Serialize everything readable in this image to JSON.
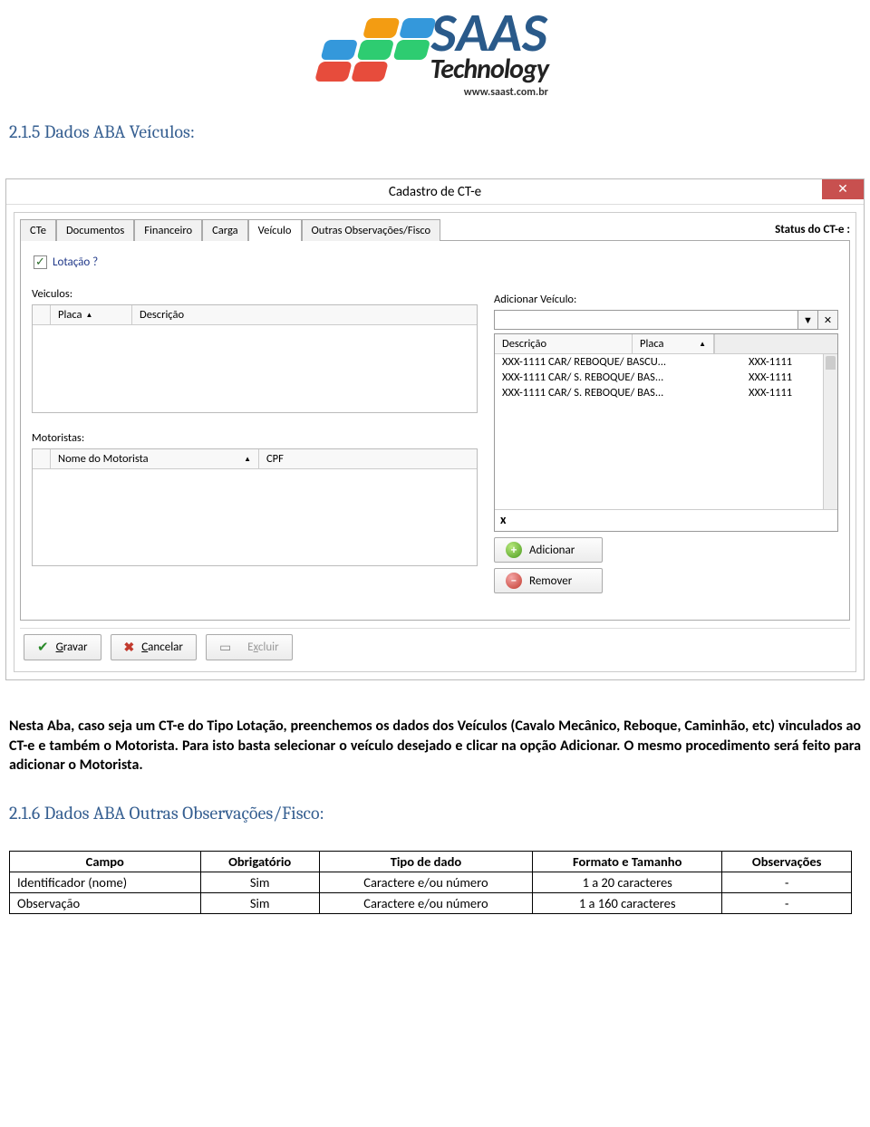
{
  "logo": {
    "brand_top": "SAAS",
    "brand_bottom": "Technology",
    "url": "www.saast.com.br"
  },
  "section1": {
    "heading": "2.1.5 Dados ABA Veículos:"
  },
  "window": {
    "title": "Cadastro de CT-e",
    "close": "✕",
    "status_label": "Status do CT-e :",
    "tabs": [
      "CTe",
      "Documentos",
      "Financeiro",
      "Carga",
      "Veículo",
      "Outras Observações/Fisco"
    ],
    "active_tab": "Veículo",
    "lotacao_label": "Lotação ?",
    "veiculos": {
      "title": "Veiculos:",
      "cols": [
        "Placa",
        "Descrição"
      ]
    },
    "motoristas": {
      "title": "Motoristas:",
      "cols": [
        "Nome do Motorista",
        "CPF"
      ]
    },
    "add_veiculo": {
      "title": "Adicionar Veículo:",
      "cols": [
        "Descrição",
        "Placa"
      ],
      "rows": [
        {
          "desc": "XXX-1111 CAR/ REBOQUE/ BASCU...",
          "placa": "XXX-1111"
        },
        {
          "desc": "XXX-1111 CAR/ S. REBOQUE/ BAS...",
          "placa": "XXX-1111"
        },
        {
          "desc": "XXX-1111 CAR/ S. REBOQUE/ BAS...",
          "placa": "XXX-1111"
        }
      ],
      "close_filter": "x",
      "btn_add": "Adicionar",
      "btn_rem": "Remover"
    },
    "footer": {
      "save": "Gravar",
      "cancel": "Cancelar",
      "delete": "Excluir"
    }
  },
  "paragraph": "Nesta Aba, caso seja um CT-e do Tipo Lotação, preenchemos os dados dos Veículos (Cavalo Mecânico, Reboque, Caminhão, etc) vinculados ao CT-e e também o Motorista. Para isto basta selecionar o veículo desejado e clicar na opção Adicionar. O mesmo procedimento será feito para adicionar o Motorista.",
  "section2": {
    "heading": "2.1.6 Dados ABA Outras Observações/Fisco:"
  },
  "spec": {
    "headers": [
      "Campo",
      "Obrigatório",
      "Tipo de dado",
      "Formato e Tamanho",
      "Observações"
    ],
    "rows": [
      {
        "campo": "Identificador (nome)",
        "obr": "Sim",
        "tipo": "Caractere e/ou número",
        "fmt": "1 a 20 caracteres",
        "obs": "-"
      },
      {
        "campo": "Observação",
        "obr": "Sim",
        "tipo": "Caractere e/ou número",
        "fmt": "1 a 160 caracteres",
        "obs": "-"
      }
    ]
  }
}
